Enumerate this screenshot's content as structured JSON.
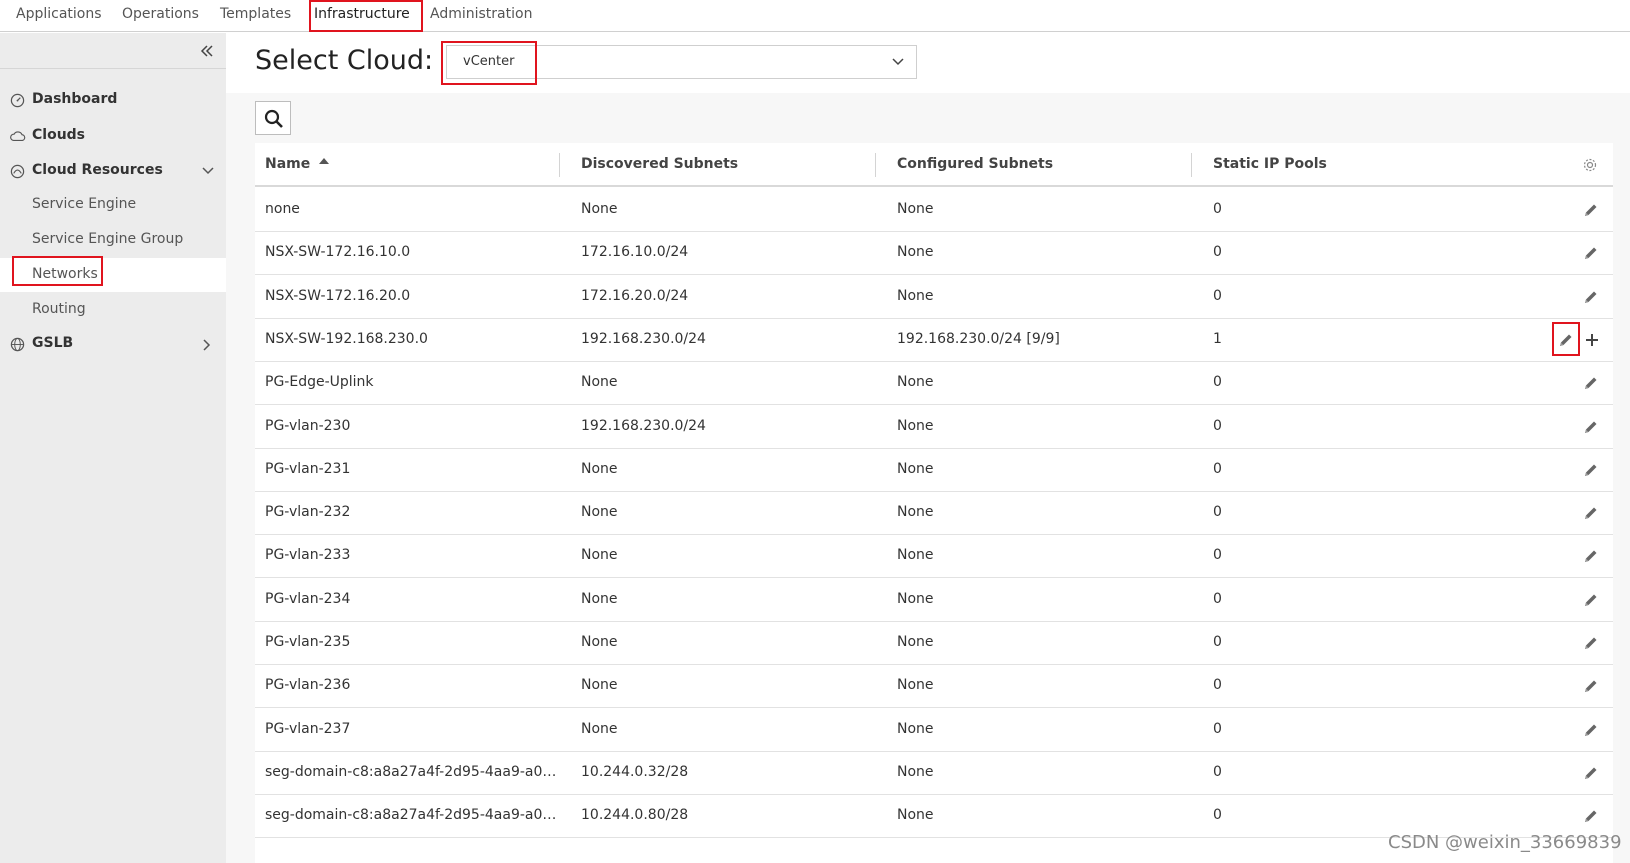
{
  "topnav": {
    "tabs": [
      {
        "label": "Applications"
      },
      {
        "label": "Operations"
      },
      {
        "label": "Templates"
      },
      {
        "label": "Infrastructure"
      },
      {
        "label": "Administration"
      }
    ],
    "active_tab": "Infrastructure"
  },
  "sidebar": {
    "items": [
      {
        "label": "Dashboard",
        "icon": "dashboard-gauge-icon"
      },
      {
        "label": "Clouds",
        "icon": "cloud-icon"
      },
      {
        "label": "Cloud Resources",
        "icon": "cloud-resources-icon",
        "expanded": true
      },
      {
        "label": "GSLB",
        "icon": "globe-icon",
        "expanded": false
      }
    ],
    "cloud_resources_children": [
      {
        "label": "Service Engine"
      },
      {
        "label": "Service Engine Group"
      },
      {
        "label": "Networks",
        "selected": true
      },
      {
        "label": "Routing"
      }
    ]
  },
  "header": {
    "title": "Select Cloud:",
    "cloud_select_value": "vCenter"
  },
  "grid": {
    "columns": [
      {
        "label": "Name",
        "sorted": "ascending"
      },
      {
        "label": "Discovered Subnets"
      },
      {
        "label": "Configured Subnets"
      },
      {
        "label": "Static IP Pools"
      }
    ],
    "rows": [
      {
        "name": "none",
        "discovered": "None",
        "configured": "None",
        "pools": "0"
      },
      {
        "name": "NSX-SW-172.16.10.0",
        "discovered": "172.16.10.0/24",
        "configured": "None",
        "pools": "0"
      },
      {
        "name": "NSX-SW-172.16.20.0",
        "discovered": "172.16.20.0/24",
        "configured": "None",
        "pools": "0"
      },
      {
        "name": "NSX-SW-192.168.230.0",
        "discovered": "192.168.230.0/24",
        "configured": "192.168.230.0/24 [9/9]",
        "pools": "1"
      },
      {
        "name": "PG-Edge-Uplink",
        "discovered": "None",
        "configured": "None",
        "pools": "0"
      },
      {
        "name": "PG-vlan-230",
        "discovered": "192.168.230.0/24",
        "configured": "None",
        "pools": "0"
      },
      {
        "name": "PG-vlan-231",
        "discovered": "None",
        "configured": "None",
        "pools": "0"
      },
      {
        "name": "PG-vlan-232",
        "discovered": "None",
        "configured": "None",
        "pools": "0"
      },
      {
        "name": "PG-vlan-233",
        "discovered": "None",
        "configured": "None",
        "pools": "0"
      },
      {
        "name": "PG-vlan-234",
        "discovered": "None",
        "configured": "None",
        "pools": "0"
      },
      {
        "name": "PG-vlan-235",
        "discovered": "None",
        "configured": "None",
        "pools": "0"
      },
      {
        "name": "PG-vlan-236",
        "discovered": "None",
        "configured": "None",
        "pools": "0"
      },
      {
        "name": "PG-vlan-237",
        "discovered": "None",
        "configured": "None",
        "pools": "0"
      },
      {
        "name": "seg-domain-c8:a8a27a4f-2d95-4aa9-a0…",
        "discovered": "10.244.0.32/28",
        "configured": "None",
        "pools": "0"
      },
      {
        "name": "seg-domain-c8:a8a27a4f-2d95-4aa9-a0…",
        "discovered": "10.244.0.80/28",
        "configured": "None",
        "pools": "0"
      }
    ]
  },
  "icons": {
    "collapse": "double-chevron-left-icon",
    "search": "search-icon",
    "settings": "gear-icon",
    "edit": "pencil-icon",
    "add": "plus-icon"
  },
  "colors": {
    "highlight": "#e0141e",
    "sidebar_bg": "#ececec"
  },
  "watermark": "CSDN @weixin_33669839"
}
